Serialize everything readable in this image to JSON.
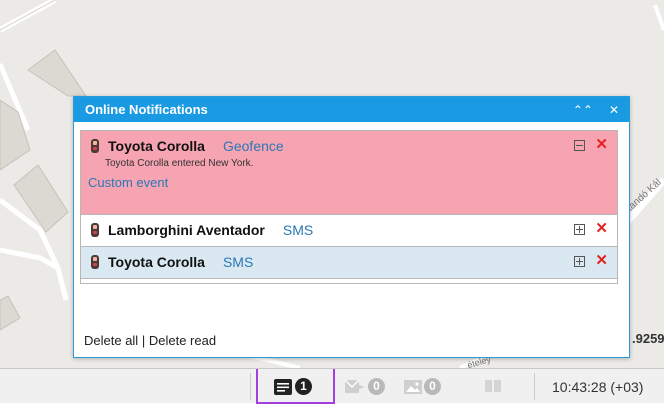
{
  "map": {
    "street_label": "Kandó Kál",
    "street_label_2": "ételey",
    "coord_fragment": ".9259"
  },
  "panel": {
    "title": "Online Notifications",
    "notifications": [
      {
        "vehicle": "Toyota Corolla",
        "type": "Geofence",
        "description": "Toyota Corolla entered New York.",
        "extra": "Custom event",
        "expanded": true,
        "bg": "#f6a4b2"
      },
      {
        "vehicle": "Lamborghini Aventador",
        "type": "SMS",
        "expanded": false,
        "bg": "#ffffff"
      },
      {
        "vehicle": "Toyota Corolla",
        "type": "SMS",
        "expanded": false,
        "bg": "#d9e8f1"
      }
    ],
    "delete_all": "Delete all",
    "separator": "|",
    "delete_read": "Delete read"
  },
  "statusbar": {
    "notifications_count": "1",
    "messages_count": "0",
    "images_count": "0",
    "time": "10:43:28 (+03)"
  },
  "colors": {
    "header": "#1b9ae4",
    "highlight": "#a43ee0",
    "close": "#e52222",
    "link": "#2a78b6"
  }
}
